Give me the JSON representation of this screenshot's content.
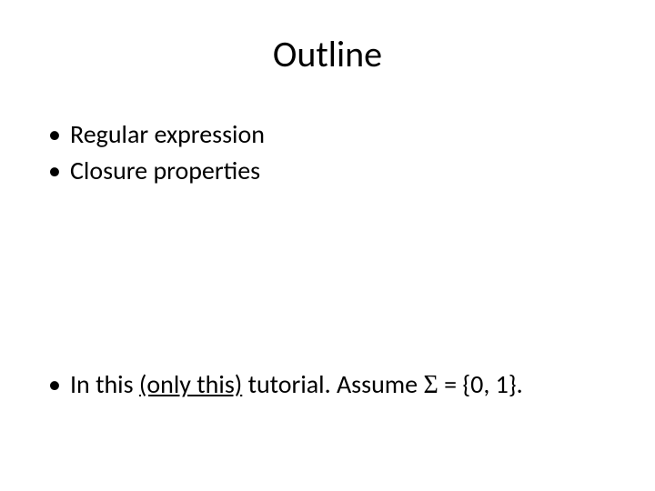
{
  "title": "Outline",
  "bullets": {
    "top": [
      "Regular expression",
      "Closure properties"
    ],
    "bottom": {
      "prefix": "In this ",
      "underlined": "(only this)",
      "middle": " tutorial. Assume ",
      "sigma": "Σ",
      "suffix": " = {0, 1}."
    }
  },
  "bullet_char": "•"
}
